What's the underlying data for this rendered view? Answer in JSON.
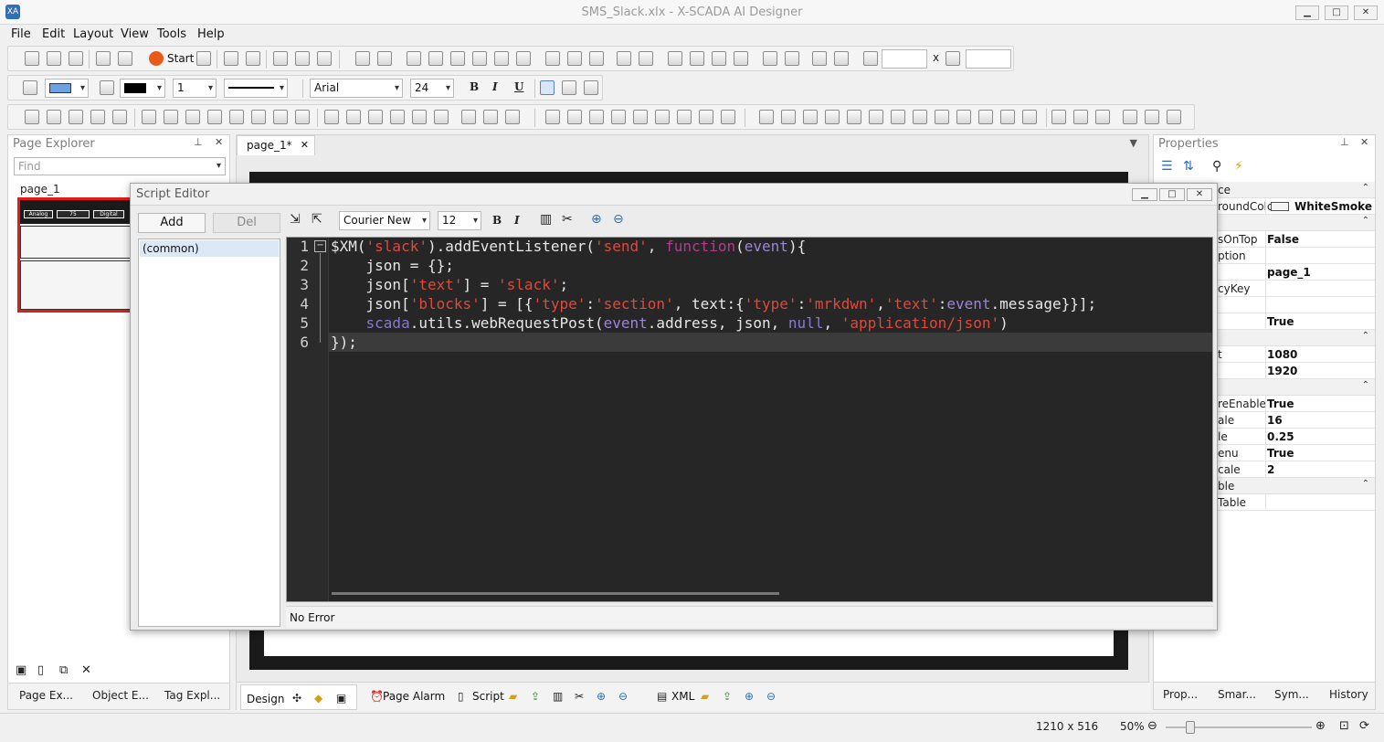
{
  "window": {
    "title": "SMS_Slack.xlx - X-SCADA AI Designer",
    "app_icon": "XA"
  },
  "menu": [
    "File",
    "Edit",
    "Layout",
    "View",
    "Tools",
    "Help"
  ],
  "toolbar": {
    "start_label": "Start",
    "size_sep": "x",
    "line_width": "1",
    "font_name": "Arial",
    "font_size": "24",
    "bold": "B",
    "italic": "I",
    "underline": "U"
  },
  "page_explorer": {
    "title": "Page Explorer",
    "find_placeholder": "Find",
    "page_name": "page_1",
    "thumb_buttons": [
      "Analog",
      "75",
      "Digital"
    ],
    "bottom_tabs": [
      "Page Ex...",
      "Object E...",
      "Tag Expl..."
    ]
  },
  "document": {
    "tab_label": "page_1*",
    "design_tabs": [
      "Design",
      "Page Alarm",
      "Script",
      "XML"
    ]
  },
  "properties": {
    "title": "Properties",
    "rows": [
      {
        "key": "ce",
        "value": "",
        "group": true
      },
      {
        "key": "roundColc",
        "value": "WhiteSmoke"
      },
      {
        "key": "",
        "value": "",
        "group": true
      },
      {
        "key": "sOnTop",
        "value": "False"
      },
      {
        "key": "ption",
        "value": ""
      },
      {
        "key": "",
        "value": "page_1"
      },
      {
        "key": "cyKey",
        "value": ""
      },
      {
        "key": "",
        "value": ""
      },
      {
        "key": "",
        "value": "True"
      },
      {
        "key": "",
        "value": "",
        "group": true
      },
      {
        "key": "t",
        "value": "1080"
      },
      {
        "key": "",
        "value": "1920"
      },
      {
        "key": "",
        "value": "",
        "group": true
      },
      {
        "key": "reEnable",
        "value": "True"
      },
      {
        "key": "ale",
        "value": "16"
      },
      {
        "key": "le",
        "value": "0.25"
      },
      {
        "key": "enu",
        "value": "True"
      },
      {
        "key": "cale",
        "value": "2"
      },
      {
        "key": "ble",
        "value": "",
        "group": true
      },
      {
        "key": "Table",
        "value": ""
      }
    ],
    "bottom_tabs": [
      "Prop...",
      "Smar...",
      "Sym...",
      "History"
    ]
  },
  "script_editor": {
    "title": "Script Editor",
    "add_label": "Add",
    "del_label": "Del",
    "font_name": "Courier New",
    "font_size": "12",
    "bold": "B",
    "italic": "I",
    "list_items": [
      "(common)"
    ],
    "line_numbers": [
      "1",
      "2",
      "3",
      "4",
      "5",
      "6"
    ],
    "status": "No Error"
  },
  "statusbar": {
    "dimensions": "1210 x 516",
    "zoom": "50%"
  },
  "colors": {
    "string": "#e0483b",
    "keyword": "#b23b8e",
    "event": "#9a86d6",
    "editor_bg": "#262626",
    "selection_red": "#e21b1b"
  }
}
